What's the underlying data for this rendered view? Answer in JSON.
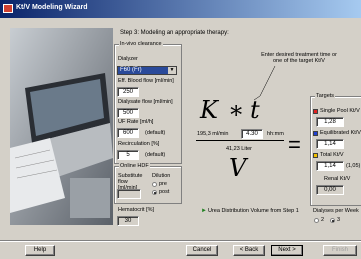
{
  "window": {
    "title": "Kt/V Modeling Wizard"
  },
  "step": "Step 3: Modeling an appropriate therapy:",
  "invivo": {
    "legend": "In-vivo clearance",
    "dialyzer_label": "Dialyzer",
    "dialyzer_value": "F60 (Fr)",
    "blood_flow_label": "Eff. Blood flow [ml/min]",
    "blood_flow_value": "250",
    "dialysate_flow_label": "Dialysate flow [ml/min]",
    "dialysate_flow_value": "500",
    "uf_rate_label": "UF Rate [ml/h]",
    "uf_rate_value": "600",
    "uf_rate_default": "(default)",
    "recirc_label": "Recirculation [%]",
    "recirc_value": "5",
    "recirc_default": "(default)"
  },
  "hdf": {
    "legend": "Online HDF",
    "substitute_label": "Substitute flow [ml/min]",
    "dilution_label": "Dilution",
    "pre_label": "pre",
    "post_label": "post",
    "selected": "post"
  },
  "hematocrit": {
    "label": "Hematocrit [%]",
    "value": "30"
  },
  "formula": {
    "K": "K",
    "t": "t",
    "V": "V",
    "clearance": "195,3 ml/min",
    "time_value": "4.30",
    "time_unit": "hh:mm",
    "volume": "41,23 Liter",
    "volume_note": "Urea Distribution Volume from Step 1",
    "hint": "Enter desired treatment time or one of the target Kt/V"
  },
  "targets": {
    "legend": "Targets",
    "single_label": "Single Pool Kt/V",
    "single_value": "1,28",
    "single_color": "#e02020",
    "equil_label": "Equilibrated Kt/V",
    "equil_value": "1,14",
    "equil_color": "#2040d0",
    "total_label": "Total Kt/V",
    "total_value": "1,14",
    "total_extra": "(1,05)",
    "total_color": "#f0c000",
    "renal_label": "Renal Kt/V",
    "renal_value": "0,00",
    "dialyses_label": "Dialyses per Week",
    "opt_2": "2",
    "opt_3": "3",
    "selected": "3"
  },
  "buttons": {
    "help": "Help",
    "cancel": "Cancel",
    "back": "< Back",
    "next": "Next >",
    "finish": "Finish"
  }
}
